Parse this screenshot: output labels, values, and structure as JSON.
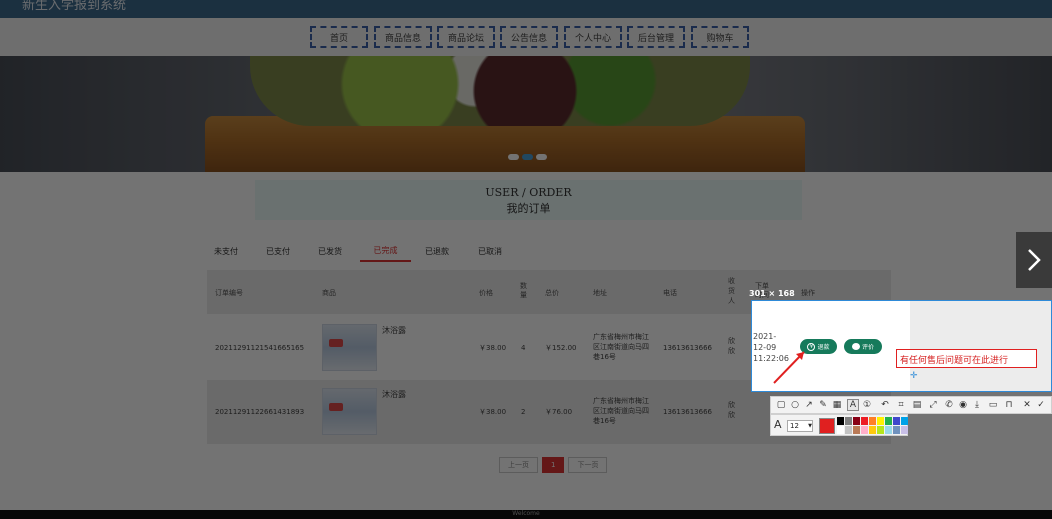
{
  "site": {
    "title": "新生入学报到系统"
  },
  "nav": {
    "items": [
      "首页",
      "商品信息",
      "商品论坛",
      "公告信息",
      "个人中心",
      "后台管理",
      "购物车"
    ]
  },
  "banner": {
    "dots": 3,
    "active_dot": 1
  },
  "header": {
    "en": "USER / ORDER",
    "cn": "我的订单"
  },
  "tabs": {
    "items": [
      "未支付",
      "已支付",
      "已发货",
      "已完成",
      "已退款",
      "已取消"
    ],
    "active": "已完成"
  },
  "table": {
    "columns": [
      "订单编号",
      "商品",
      "价格",
      "数量",
      "总价",
      "地址",
      "电话",
      "收货人",
      "下单时间",
      "操作"
    ],
    "rows": [
      {
        "order_no": "20211291121541665165",
        "product": "沐浴露",
        "price": "￥38.00",
        "qty": "4",
        "total": "￥152.00",
        "address": "广东省梅州市梅江区江南街道向马四巷16号",
        "phone": "13613613666",
        "receiver": "欣欣"
      },
      {
        "order_no": "2021129112266143189З",
        "product": "沐浴露",
        "price": "￥38.00",
        "qty": "2",
        "total": "￥76.00",
        "address": "广东省梅州市梅江区江南街道向马四巷16号",
        "phone": "13613613666",
        "receiver": "欣欣"
      }
    ]
  },
  "pager": {
    "prev": "上一页",
    "current": "1",
    "next": "下一页"
  },
  "footer": {
    "text": "Welcome"
  },
  "capture": {
    "size_label": "301 × 168",
    "date_line1": "2021-",
    "date_line2": "12-09",
    "date_line3": "11:22:06",
    "pay_label": "退款",
    "review_label": "评价",
    "annotation": "有任何售后问题可在此进行"
  },
  "props": {
    "font_size": "12",
    "current_color": "#e02020"
  },
  "palette": [
    "#000000",
    "#7f7f7f",
    "#880015",
    "#ed1c24",
    "#ff7f27",
    "#fff200",
    "#22b14c",
    "#3f48cc",
    "#00a2e8",
    "#ffffff",
    "#c3c3c3",
    "#b97a57",
    "#ffaec9",
    "#ffc90e",
    "#b5e61d",
    "#99d9ea",
    "#7092be",
    "#c8bfe7"
  ]
}
